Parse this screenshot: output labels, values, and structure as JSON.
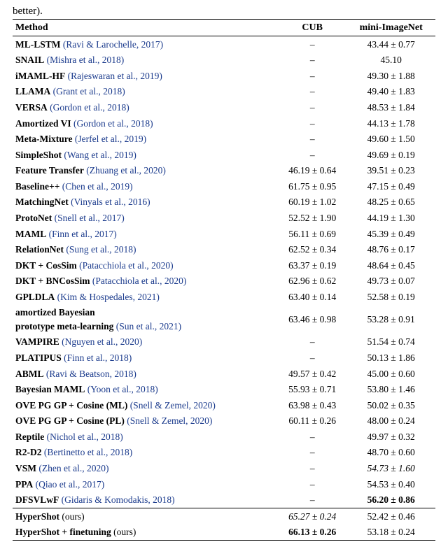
{
  "pretext": "better).",
  "headers": {
    "method": "Method",
    "cub": "CUB",
    "mini": "mini-ImageNet"
  },
  "rows": [
    {
      "method": "ML-LSTM",
      "cite": "(Ravi & Larochelle, 2017)",
      "cub": "–",
      "mini": "43.44 ± 0.77"
    },
    {
      "method": "SNAIL",
      "cite": "(Mishra et al., 2018)",
      "cub": "–",
      "mini": "45.10"
    },
    {
      "method": "iMAML-HF",
      "cite": "(Rajeswaran et al., 2019)",
      "cub": "–",
      "mini": "49.30 ± 1.88"
    },
    {
      "method": "LLAMA",
      "cite": "(Grant et al., 2018)",
      "cub": "–",
      "mini": "49.40 ± 1.83"
    },
    {
      "method": "VERSA",
      "cite": "(Gordon et al., 2018)",
      "cub": "–",
      "mini": "48.53 ± 1.84"
    },
    {
      "method": "Amortized VI",
      "cite": "(Gordon et al., 2018)",
      "cub": "–",
      "mini": "44.13 ± 1.78"
    },
    {
      "method": "Meta-Mixture",
      "cite": "(Jerfel et al., 2019)",
      "cub": "–",
      "mini": "49.60 ± 1.50"
    },
    {
      "method": "SimpleShot",
      "cite": "(Wang et al., 2019)",
      "cub": "–",
      "mini": "49.69 ± 0.19"
    },
    {
      "method": "Feature Transfer",
      "cite": "(Zhuang et al., 2020)",
      "cub": "46.19 ± 0.64",
      "mini": "39.51 ± 0.23"
    },
    {
      "method": "Baseline++",
      "cite": "(Chen et al., 2019)",
      "cub": "61.75 ± 0.95",
      "mini": "47.15 ± 0.49"
    },
    {
      "method": "MatchingNet",
      "cite": "(Vinyals et al., 2016)",
      "cub": "60.19 ± 1.02",
      "mini": "48.25 ± 0.65"
    },
    {
      "method": "ProtoNet",
      "cite": "(Snell et al., 2017)",
      "cub": "52.52 ± 1.90",
      "mini": "44.19 ± 1.30"
    },
    {
      "method": "MAML",
      "cite": "(Finn et al., 2017)",
      "cub": "56.11 ± 0.69",
      "mini": "45.39 ± 0.49"
    },
    {
      "method": "RelationNet",
      "cite": "(Sung et al., 2018)",
      "cub": "62.52 ± 0.34",
      "mini": "48.76 ± 0.17"
    },
    {
      "method": "DKT + CosSim",
      "cite": "(Patacchiola et al., 2020)",
      "cub": "63.37 ± 0.19",
      "mini": "48.64 ± 0.45"
    },
    {
      "method": "DKT + BNCosSim",
      "cite": "(Patacchiola et al., 2020)",
      "cub": "62.96 ± 0.62",
      "mini": "49.73 ± 0.07"
    },
    {
      "method": "GPLDLA",
      "cite": "(Kim & Hospedales, 2021)",
      "cub": "63.40 ± 0.14",
      "mini": "52.58 ± 0.19"
    },
    {
      "method": "amortized Bayesian",
      "method2": "prototype meta-learning",
      "cite": "(Sun et al., 2021)",
      "cub": "63.46 ± 0.98",
      "mini": "53.28 ± 0.91",
      "twoLine": true
    },
    {
      "method": "VAMPIRE",
      "cite": "(Nguyen et al., 2020)",
      "cub": "–",
      "mini": "51.54 ± 0.74"
    },
    {
      "method": "PLATIPUS",
      "cite": "(Finn et al., 2018)",
      "cub": "–",
      "mini": "50.13 ± 1.86"
    },
    {
      "method": "ABML",
      "cite": "(Ravi & Beatson, 2018)",
      "cub": "49.57 ± 0.42",
      "mini": "45.00 ± 0.60"
    },
    {
      "method": "Bayesian MAML",
      "cite": "(Yoon et al., 2018)",
      "cub": "55.93 ± 0.71",
      "mini": "53.80 ± 1.46"
    },
    {
      "method": "OVE PG GP + Cosine (ML)",
      "cite": "(Snell & Zemel, 2020)",
      "cub": "63.98 ± 0.43",
      "mini": "50.02 ± 0.35"
    },
    {
      "method": "OVE PG GP + Cosine (PL)",
      "cite": "(Snell & Zemel, 2020)",
      "cub": "60.11 ± 0.26",
      "mini": "48.00 ± 0.24"
    },
    {
      "method": "Reptile",
      "cite": "(Nichol et al., 2018)",
      "cub": "–",
      "mini": "49.97 ± 0.32"
    },
    {
      "method": "R2-D2",
      "cite": "(Bertinetto et al., 2018)",
      "cub": "–",
      "mini": "48.70 ± 0.60"
    },
    {
      "method": "VSM",
      "cite": "(Zhen et al., 2020)",
      "cub": "–",
      "mini": "54.73 ± 1.60",
      "miniItalic": true
    },
    {
      "method": "PPA",
      "cite": "(Qiao et al., 2017)",
      "cub": "–",
      "mini": "54.53 ± 0.40"
    },
    {
      "method": "DFSVLwF",
      "cite": "(Gidaris & Komodakis, 2018)",
      "cub": "–",
      "mini": "56.20 ± 0.86",
      "miniBold": true
    }
  ],
  "ours": [
    {
      "method": "HyperShot",
      "suffix": " (ours)",
      "cub": "65.27 ± 0.24",
      "cubItalic": true,
      "mini": "52.42 ± 0.46"
    },
    {
      "method": "HyperShot + finetuning",
      "suffix": " (ours)",
      "cub": "66.13 ± 0.26",
      "cubBold": true,
      "mini": "53.18 ± 0.24"
    }
  ]
}
